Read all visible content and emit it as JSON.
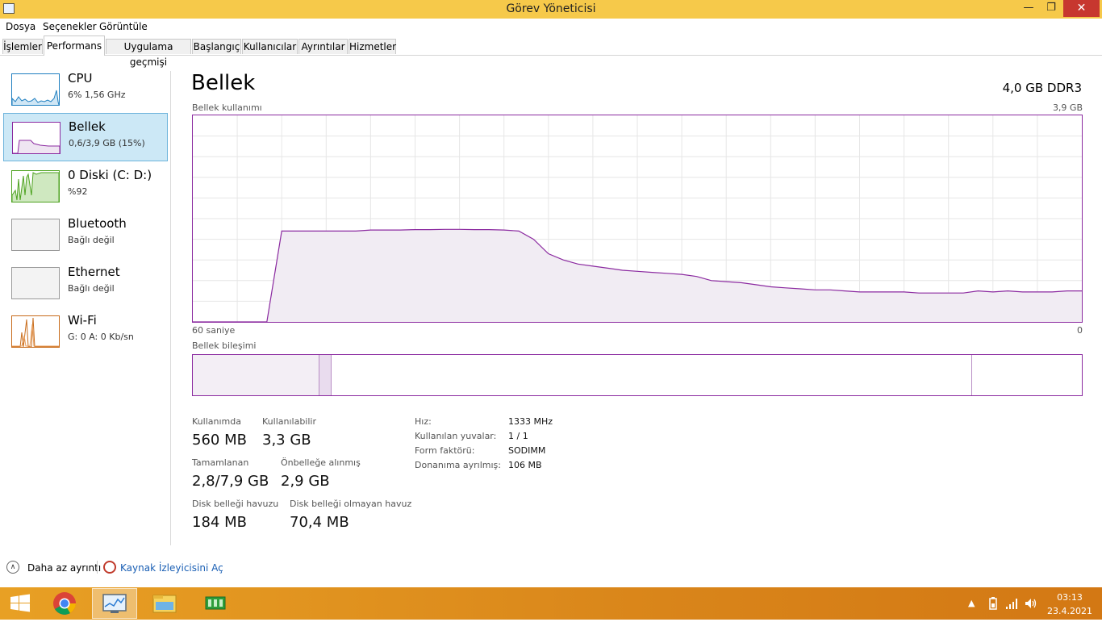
{
  "window": {
    "title": "Görev Yöneticisi",
    "minimize": "—",
    "maximize": "❐",
    "close": "✕"
  },
  "menu": [
    "Dosya",
    "Seçenekler",
    "Görüntüle"
  ],
  "tabs": [
    "İşlemler",
    "Performans",
    "Uygulama geçmişi",
    "Başlangıç",
    "Kullanıcılar",
    "Ayrıntılar",
    "Hizmetler"
  ],
  "active_tab": "Performans",
  "sidebar": [
    {
      "title": "CPU",
      "subtitle": "6%  1,56 GHz",
      "icon": "cpu-graph",
      "color": "#1f7fc0"
    },
    {
      "title": "Bellek",
      "subtitle": "0,6/3,9 GB (15%)",
      "icon": "memory-graph",
      "color": "#8b2aa0",
      "selected": true
    },
    {
      "title": "0 Diski (C: D:)",
      "subtitle": "%92",
      "icon": "disk-graph",
      "color": "#4da21f"
    },
    {
      "title": "Bluetooth",
      "subtitle": "Bağlı değil",
      "icon": "bluetooth-graph",
      "color": "#999999"
    },
    {
      "title": "Ethernet",
      "subtitle": "Bağlı değil",
      "icon": "ethernet-graph",
      "color": "#999999"
    },
    {
      "title": "Wi-Fi",
      "subtitle": "G: 0  A: 0 Kb/sn",
      "icon": "wifi-graph",
      "color": "#c86b1a"
    }
  ],
  "main": {
    "heading": "Bellek",
    "memory_type": "4,0 GB DDR3",
    "usage_label": "Bellek kullanımı",
    "usage_max": "3,9 GB",
    "axis_left": "60 saniye",
    "axis_right": "0",
    "composition_label": "Bellek bileşimi",
    "composition": {
      "in_use_fraction": 0.142,
      "modified_fraction": 0.014,
      "standby_end_fraction": 0.876
    },
    "usage_history_fraction": [
      0,
      0,
      0,
      0,
      0,
      0,
      0.44,
      0.44,
      0.44,
      0.44,
      0.44,
      0.44,
      0.445,
      0.445,
      0.445,
      0.447,
      0.447,
      0.448,
      0.448,
      0.447,
      0.447,
      0.445,
      0.44,
      0.4,
      0.33,
      0.3,
      0.28,
      0.27,
      0.26,
      0.25,
      0.245,
      0.24,
      0.235,
      0.23,
      0.22,
      0.2,
      0.195,
      0.19,
      0.18,
      0.17,
      0.165,
      0.16,
      0.155,
      0.155,
      0.15,
      0.145,
      0.145,
      0.145,
      0.145,
      0.14,
      0.14,
      0.14,
      0.14,
      0.15,
      0.145,
      0.15,
      0.145,
      0.145,
      0.145,
      0.15,
      0.15
    ],
    "graph_color": "#8b2aa0",
    "stats": [
      {
        "label": "Kullanımda",
        "value": "560 MB"
      },
      {
        "label": "Kullanılabilir",
        "value": "3,3 GB"
      },
      {
        "label": "Tamamlanan",
        "value": "2,8/7,9 GB"
      },
      {
        "label": "Önbelleğe alınmış",
        "value": "2,9 GB"
      },
      {
        "label": "Disk belleği havuzu",
        "value": "184 MB"
      },
      {
        "label": "Disk belleği olmayan havuz",
        "value": "70,4 MB"
      }
    ],
    "info": [
      {
        "label": "Hız:",
        "value": "1333 MHz"
      },
      {
        "label": "Kullanılan yuvalar:",
        "value": "1 / 1"
      },
      {
        "label": "Form faktörü:",
        "value": "SODIMM"
      },
      {
        "label": "Donanıma ayrılmış:",
        "value": "106 MB"
      }
    ]
  },
  "footer": {
    "less_details": "Daha az ayrıntı",
    "resource_monitor": "Kaynak İzleyicisini Aç"
  },
  "taskbar": {
    "apps": [
      "start-icon",
      "chrome-icon",
      "task-manager-icon",
      "file-explorer-icon",
      "app-icon"
    ],
    "clock_time": "03:13",
    "clock_date": "23.4.2021",
    "tray": [
      "chevron-up-icon",
      "battery-icon",
      "signal-icon",
      "volume-icon"
    ]
  }
}
